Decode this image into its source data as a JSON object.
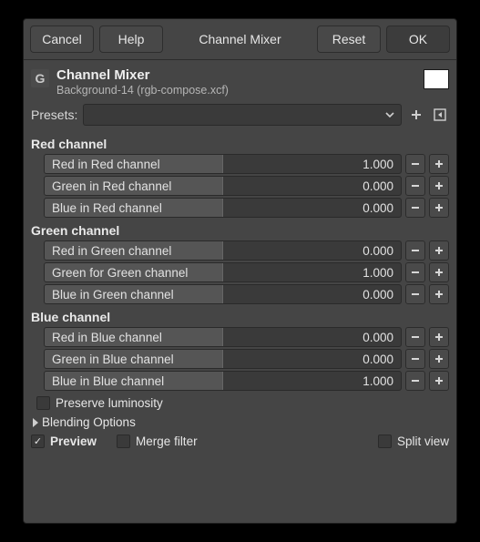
{
  "buttons": {
    "cancel": "Cancel",
    "help": "Help",
    "title": "Channel Mixer",
    "reset": "Reset",
    "ok": "OK"
  },
  "header": {
    "title": "Channel Mixer",
    "subtitle": "Background-14 (rgb-compose.xcf)",
    "swatch_color": "#ffffff"
  },
  "presets": {
    "label": "Presets:",
    "value": ""
  },
  "channels": [
    {
      "title": "Red channel",
      "rows": [
        {
          "label": "Red in Red channel",
          "value": "1.000",
          "fill": 50
        },
        {
          "label": "Green in Red channel",
          "value": "0.000",
          "fill": 50
        },
        {
          "label": "Blue in Red channel",
          "value": "0.000",
          "fill": 50
        }
      ]
    },
    {
      "title": "Green channel",
      "rows": [
        {
          "label": "Red in Green channel",
          "value": "0.000",
          "fill": 50
        },
        {
          "label": "Green for Green channel",
          "value": "1.000",
          "fill": 50
        },
        {
          "label": "Blue in Green channel",
          "value": "0.000",
          "fill": 50
        }
      ]
    },
    {
      "title": "Blue channel",
      "rows": [
        {
          "label": "Red in Blue channel",
          "value": "0.000",
          "fill": 50
        },
        {
          "label": "Green in Blue channel",
          "value": "0.000",
          "fill": 50
        },
        {
          "label": "Blue in Blue channel",
          "value": "1.000",
          "fill": 50
        }
      ]
    }
  ],
  "options": {
    "preserve_luminosity": {
      "label": "Preserve luminosity",
      "checked": false
    },
    "blending_options": {
      "label": "Blending Options"
    },
    "preview": {
      "label": "Preview",
      "checked": true
    },
    "merge_filter": {
      "label": "Merge filter",
      "checked": false
    },
    "split_view": {
      "label": "Split view",
      "checked": false
    }
  }
}
